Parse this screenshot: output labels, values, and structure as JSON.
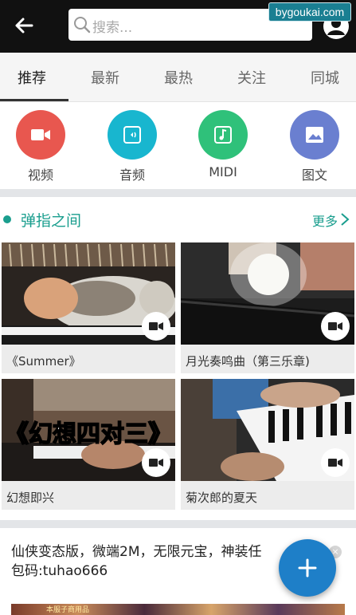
{
  "header": {
    "search_placeholder": "搜索...",
    "watermark": "bygoukai.com"
  },
  "tabs": [
    {
      "label": "推荐",
      "active": true
    },
    {
      "label": "最新",
      "active": false
    },
    {
      "label": "最热",
      "active": false
    },
    {
      "label": "关注",
      "active": false
    },
    {
      "label": "同城",
      "active": false
    }
  ],
  "categories": [
    {
      "label": "视频",
      "icon": "video-icon",
      "color": "#e8574f"
    },
    {
      "label": "音频",
      "icon": "audio-icon",
      "color": "#18b6cf"
    },
    {
      "label": "MIDI",
      "icon": "midi-icon",
      "color": "#2fc17a"
    },
    {
      "label": "图文",
      "icon": "image-icon",
      "color": "#6a7fd0"
    }
  ],
  "section": {
    "title": "弹指之间",
    "more": "更多"
  },
  "cards": [
    {
      "title": "《Summer》",
      "thumb_overlay": ""
    },
    {
      "title": "月光奏鸣曲（第三乐章)",
      "thumb_overlay": ""
    },
    {
      "title": "幻想即兴",
      "thumb_overlay": "《幻想四对三》"
    },
    {
      "title": "菊次郎的夏天",
      "thumb_overlay": ""
    }
  ],
  "ad": {
    "line1": "仙侠变态版，微端2M，无限元宝，神装任",
    "line2": "包码:tuhao666",
    "close": "×",
    "banner_text": "本服子商用品"
  },
  "fab": {
    "icon": "plus-icon"
  },
  "colors": {
    "accent": "#1a9e8e",
    "fab": "#1e7fc8",
    "topbar": "#111111"
  }
}
